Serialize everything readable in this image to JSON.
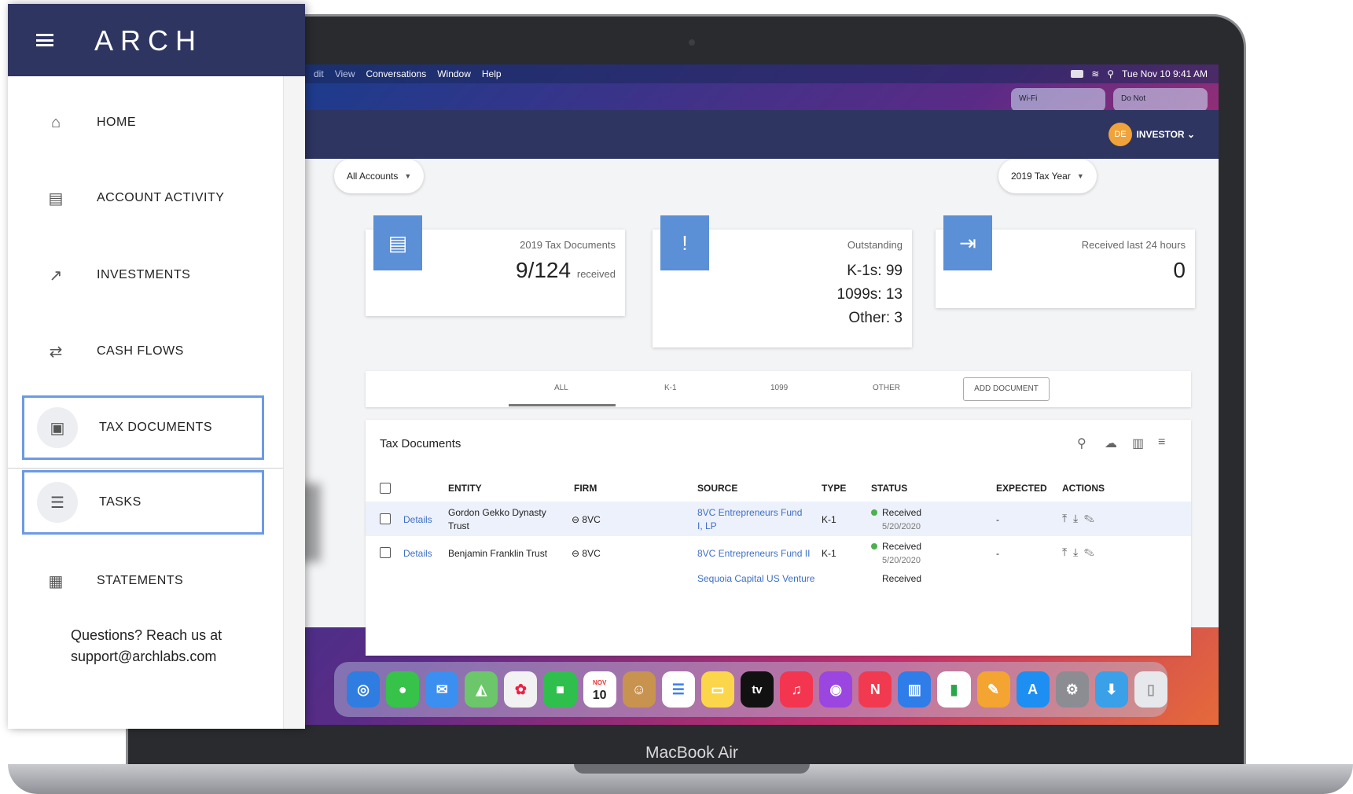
{
  "sidebar": {
    "brand": "ARCH",
    "items": [
      {
        "label": "HOME",
        "icon": "home-icon",
        "glyph": "⌂"
      },
      {
        "label": "ACCOUNT ACTIVITY",
        "icon": "calendar-icon",
        "glyph": "▤"
      },
      {
        "label": "INVESTMENTS",
        "icon": "trending-up-icon",
        "glyph": "↗"
      },
      {
        "label": "CASH FLOWS",
        "icon": "swap-arrows-icon",
        "glyph": "⇄"
      },
      {
        "label": "TAX DOCUMENTS",
        "icon": "clipboard-icon",
        "glyph": "▣"
      },
      {
        "label": "TASKS",
        "icon": "checklist-icon",
        "glyph": "☰"
      },
      {
        "label": "STATEMENTS",
        "icon": "list-document-icon",
        "glyph": "▦"
      }
    ],
    "support_line1": "Questions? Reach us at",
    "support_line2": "support@archlabs.com"
  },
  "menubar": {
    "items": [
      "dit",
      "View",
      "Conversations",
      "Window",
      "Help"
    ],
    "datetime": "Tue Nov 10  9:41 AM",
    "wifi_card": "Wi-Fi",
    "dnd_card": "Do Not"
  },
  "header": {
    "avatar_initials": "DE",
    "user_role": "INVESTOR"
  },
  "filters": {
    "accounts": "All Accounts",
    "tax_year": "2019 Tax Year"
  },
  "stats": {
    "tax_docs_title": "2019 Tax Documents",
    "tax_docs_value": "9/124",
    "tax_docs_suffix": "received",
    "outstanding_title": "Outstanding",
    "outstanding_k1": "K-1s: 99",
    "outstanding_1099": "1099s: 13",
    "outstanding_other": "Other: 3",
    "received_title": "Received last 24 hours",
    "received_value": "0"
  },
  "tabs": [
    "ALL",
    "K-1",
    "1099",
    "OTHER"
  ],
  "add_document": "ADD DOCUMENT",
  "table": {
    "title": "Tax Documents",
    "columns": [
      "ENTITY",
      "FIRM",
      "SOURCE",
      "TYPE",
      "STATUS",
      "EXPECTED",
      "ACTIONS"
    ],
    "rows": [
      {
        "details": "Details",
        "entity": "Gordon Gekko Dynasty Trust",
        "firm": "8VC",
        "source": "8VC Entrepreneurs Fund I, LP",
        "type": "K-1",
        "status": "Received",
        "status_date": "5/20/2020",
        "expected": "-"
      },
      {
        "details": "Details",
        "entity": "Benjamin Franklin Trust",
        "firm": "8VC",
        "source": "8VC Entrepreneurs Fund II",
        "type": "K-1",
        "status": "Received",
        "status_date": "5/20/2020",
        "expected": "-"
      },
      {
        "source": "Sequoia Capital US Venture",
        "status": "Received"
      }
    ]
  },
  "dock": {
    "calendar_month": "NOV",
    "calendar_day": "10",
    "tv_label": "tv"
  },
  "device_label": "MacBook Air",
  "colors": {
    "navy": "#2e3561",
    "accent_blue": "#5b8fd6",
    "active_border": "#6b9ae6",
    "link": "#3e6fc7",
    "status_green": "#4caf50"
  }
}
